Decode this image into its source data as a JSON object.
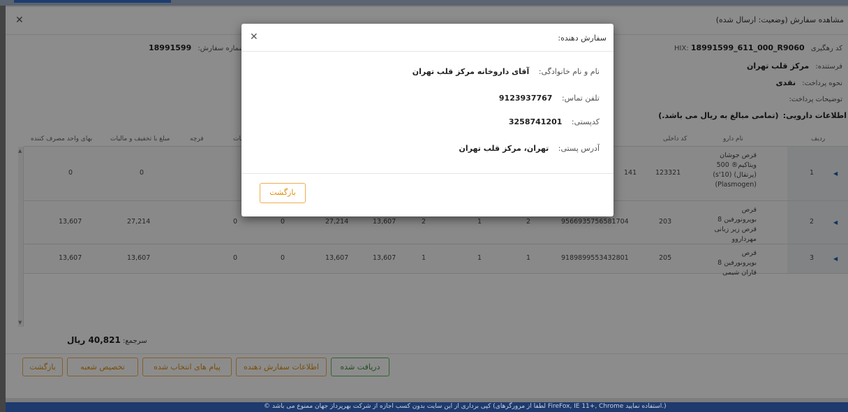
{
  "dialog": {
    "title": "مشاهده سفارش (وضعیت: ارسال شده)",
    "close_icon": "✕"
  },
  "info": {
    "tracking_label": "کد رهگیری HIX:",
    "tracking_value": "18991599_611_000_R9060",
    "sender_label": "فرستنده:",
    "sender_value": "مرکز قلب تهران",
    "payment_label": "نحوه پرداخت:",
    "payment_value": "نقدی",
    "payment_desc_label": "توضیحات پرداخت:",
    "drug_info_label": "اطلاعات دارویی:",
    "drug_info_value": "(تمامی مبالغ به ریال می باشد.)",
    "order_no_label": "شماره سفارش:",
    "order_no_value": "18991599"
  },
  "table": {
    "headers": {
      "row": "ردیف",
      "drug_name": "نام دارو",
      "internal_code": "کد داخلی",
      "taxes": "یات",
      "franchise": "فرچه",
      "discount_amount": "مبلغ با تخفیف و مالیات",
      "unit_price": "بهای واحد مصرف کننده"
    },
    "rows": [
      {
        "row": "1",
        "drug_name": "قرص جوشان ویتاکیم® 500 (پرتقال) (10's) (Plasmogen)",
        "internal_code": "123321",
        "gtin": "141",
        "c9": "0",
        "c10": "0",
        "c11": "0"
      },
      {
        "row": "2",
        "drug_name": "قرص بوپرونورفین 8 قرص زیر زبانی مهرداروو",
        "internal_code": "203",
        "gtin": "9566935756581704",
        "c1": "2",
        "c2": "1",
        "c3": "2",
        "c4": "13,607",
        "c5": "27,214",
        "c6": "0",
        "c7": "0",
        "c8": "27,214",
        "c9": "13,607"
      },
      {
        "row": "3",
        "drug_name": "قرص بوپرونورفین 8 قاران شیمی",
        "internal_code": "205",
        "gtin": "9189899553432801",
        "c1": "1",
        "c2": "1",
        "c3": "1",
        "c4": "13,607",
        "c5": "13,607",
        "c6": "0",
        "c7": "0",
        "c8": "13,607",
        "c9": "13,607"
      }
    ]
  },
  "summary": {
    "label": "سرجمع:",
    "value": "40,821 ریال"
  },
  "buttons": {
    "received": "دریافت شده",
    "orderer_info": "اطلاعات سفارش دهنده",
    "selected_messages": "پیام های انتخاب شده",
    "assign_branch": "تخصیص شعبه",
    "back": "بازگشت"
  },
  "popup": {
    "title": "سفارش دهنده:",
    "close_icon": "✕",
    "name_label": "نام و نام خانوادگی:",
    "name_value": "آقای داروخانه مرکز قلب تهران",
    "phone_label": "تلفن تماس:",
    "phone_value": "9123937767",
    "postal_label": "کدپستی:",
    "postal_value": "3258741201",
    "address_label": "آدرس پستی:",
    "address_value": "تهران، مرکز قلب تهران",
    "back_button": "بازگشت"
  },
  "footer": {
    "text": "© کپی برداری از این سایت بدون کسب اجازه از شرکت بهرپرداز جهان ممنوع می باشد (لطفا از مرورگرهای FireFox, IE 11+, Chrome استفاده نمایید.)"
  }
}
